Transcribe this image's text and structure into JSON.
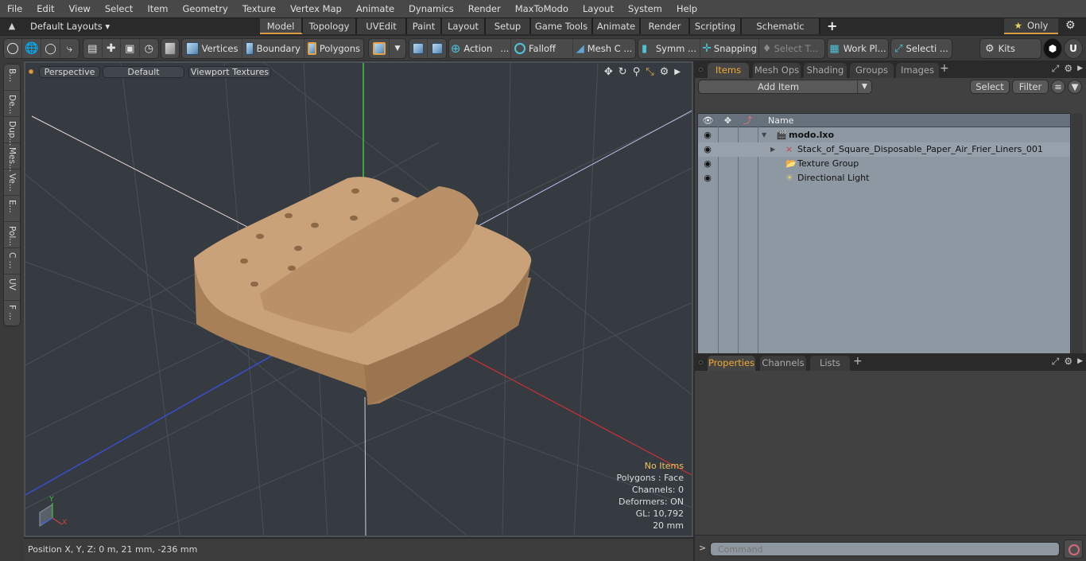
{
  "menu": [
    "File",
    "Edit",
    "View",
    "Select",
    "Item",
    "Geometry",
    "Texture",
    "Vertex Map",
    "Animate",
    "Dynamics",
    "Render",
    "MaxToModo",
    "Layout",
    "System",
    "Help"
  ],
  "layout_bar": {
    "layout_select": "Default Layouts ▾",
    "tabs": [
      "Model",
      "Topology",
      "UVEdit",
      "Paint",
      "Layout",
      "Setup",
      "Game Tools",
      "Animate",
      "Render",
      "Scripting",
      "Schematic Fusion"
    ],
    "active_tab": "Model",
    "add_tab": "+",
    "only_label": "Only",
    "star_glyph": "★",
    "gear_glyph": "⚙"
  },
  "toolbar": {
    "vertices": "Vertices",
    "boundary": "Boundary",
    "polygons": "Polygons",
    "action": "Action",
    "action_more": "...",
    "falloff": "Falloff",
    "mesh_c": "Mesh C ...",
    "symm": "Symm ...",
    "snapping": "Snapping",
    "select_t": "Select T...",
    "work_pl": "Work Pl...",
    "selecti": "Selecti ...",
    "kits": "Kits"
  },
  "left_tabs": [
    "B...",
    "De...",
    "Dup...",
    "Mes...",
    "Ve...",
    "E...",
    "Pol...",
    "C ...",
    "UV",
    "F ..."
  ],
  "viewport": {
    "view_mode": "Perspective",
    "shading": "Default",
    "textures": "Viewport Textures",
    "stats": {
      "selection": "No Items",
      "polygons": "Polygons : Face",
      "channels": "Channels: 0",
      "deformers": "Deformers: ON",
      "gl": "GL: 10,792",
      "scale": "20 mm"
    },
    "axis_labels": {
      "y": "Y",
      "x": "X"
    },
    "object_color": "#c9a27a"
  },
  "status": {
    "position": "Position X, Y, Z:   0 m, 21 mm, -236 mm"
  },
  "items_panel": {
    "tabs": [
      "Items",
      "Mesh Ops",
      "Shading",
      "Groups",
      "Images"
    ],
    "active_tab": "Items",
    "add_tab": "+",
    "add_item": "Add Item",
    "select": "Select",
    "filter": "Filter",
    "column_name": "Name",
    "tree": [
      {
        "label": "modo.lxo",
        "level": 0,
        "expanded": true,
        "icon": "scene-icon"
      },
      {
        "label": "Stack_of_Square_Disposable_Paper_Air_Frier_Liners_001",
        "level": 1,
        "expanded": false,
        "icon": "mesh-locator-icon"
      },
      {
        "label": "Texture Group",
        "level": 1,
        "icon": "texture-group-icon"
      },
      {
        "label": "Directional Light",
        "level": 1,
        "icon": "light-icon"
      }
    ]
  },
  "properties_panel": {
    "tabs": [
      "Properties",
      "Channels",
      "Lists"
    ],
    "active_tab": "Properties",
    "add_tab": "+"
  },
  "command": {
    "prompt": ">",
    "placeholder": "Command"
  }
}
